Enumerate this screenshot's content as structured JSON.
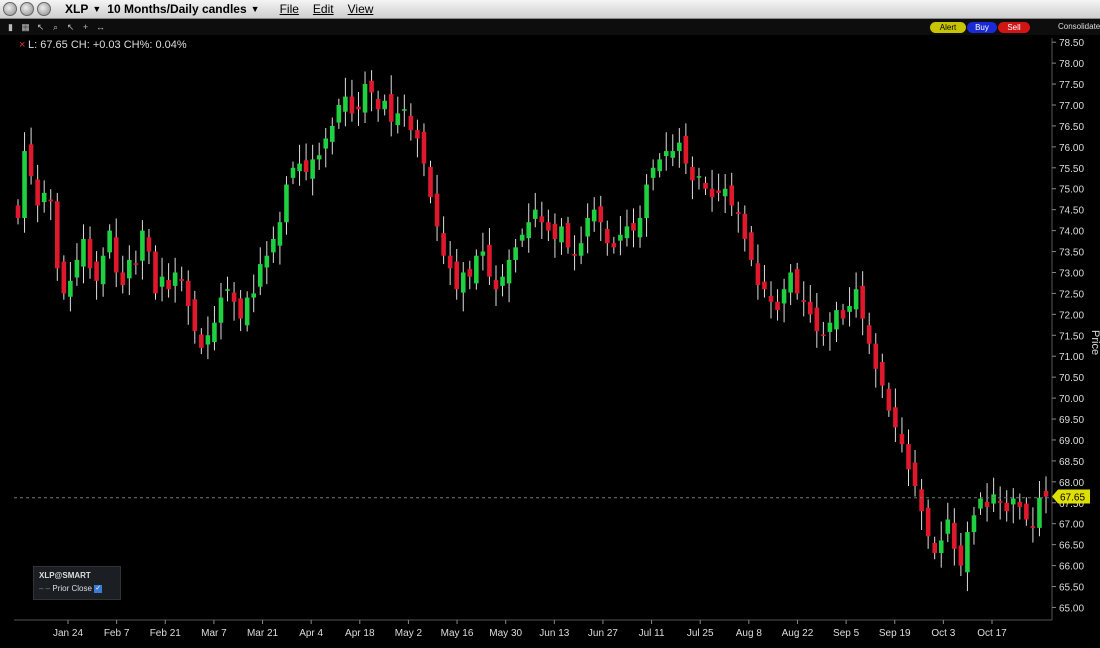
{
  "header": {
    "symbol": "XLP",
    "period": "10 Months/Daily candles",
    "menus": [
      "File",
      "Edit",
      "View"
    ],
    "consolidate": "Consolidate"
  },
  "actions": {
    "alert": "Alert",
    "buy": "Buy",
    "sell": "Sell"
  },
  "colors": {
    "up": "#1fd040",
    "down": "#e0182c",
    "alert": "#c9c400",
    "buy": "#1a2bd6",
    "sell": "#d11414",
    "price_tag": "#e0e000"
  },
  "icons": {
    "window_buttons": [
      "close-icon",
      "minimize-icon",
      "zoom-icon"
    ],
    "tools": [
      "bar-icon",
      "grid-icon",
      "cursor-icon",
      "zoom-icon",
      "cursor-icon",
      "crosshair-icon",
      "pan-icon"
    ]
  },
  "quote_line": "L: 67.65 CH: +0.03 CH%: 0.04%",
  "legend": {
    "title": "XLP@SMART",
    "prior_close": "Prior Close"
  },
  "price_tag": "67.65",
  "chart_data": {
    "type": "candlestick",
    "ylabel": "Price",
    "ylim": [
      64.7,
      78.6
    ],
    "y_ticks": [
      "78.50",
      "78.00",
      "77.50",
      "77.00",
      "76.50",
      "76.00",
      "75.50",
      "75.00",
      "74.50",
      "74.00",
      "73.50",
      "73.00",
      "72.50",
      "72.00",
      "71.50",
      "71.00",
      "70.50",
      "70.00",
      "69.50",
      "69.00",
      "68.50",
      "68.00",
      "67.50",
      "67.00",
      "66.50",
      "66.00",
      "65.50",
      "65.00"
    ],
    "x_labels": [
      "Jan 24",
      "Feb 7",
      "Feb 21",
      "Mar 7",
      "Mar 21",
      "Apr 4",
      "Apr 18",
      "May 2",
      "May 16",
      "May 30",
      "Jun 13",
      "Jun 27",
      "Jul 11",
      "Jul 25",
      "Aug 8",
      "Aug 22",
      "Sep 5",
      "Sep 19",
      "Oct 3",
      "Oct 17"
    ],
    "prior_close": 67.62,
    "last": 67.65,
    "close_path": [
      74.3,
      75.9,
      75.3,
      74.6,
      74.9,
      74.7,
      73.1,
      72.5,
      72.8,
      73.3,
      73.8,
      73.1,
      72.8,
      73.4,
      74.0,
      73.0,
      72.7,
      73.3,
      73.2,
      74.0,
      73.5,
      72.5,
      72.9,
      72.6,
      73.0,
      72.8,
      72.2,
      71.6,
      71.2,
      71.5,
      71.8,
      72.4,
      72.6,
      72.3,
      71.9,
      72.4,
      72.5,
      73.2,
      73.4,
      73.8,
      74.2,
      75.1,
      75.5,
      75.6,
      75.4,
      75.7,
      75.8,
      76.2,
      76.5,
      77.0,
      77.2,
      76.8,
      76.9,
      77.5,
      77.3,
      76.9,
      77.1,
      76.6,
      76.8,
      76.9,
      76.4,
      76.2,
      75.6,
      74.8,
      74.1,
      73.4,
      73.1,
      72.6,
      73.0,
      72.9,
      73.4,
      73.5,
      72.9,
      72.6,
      72.9,
      73.3,
      73.6,
      73.9,
      74.2,
      74.5,
      74.2,
      74.0,
      73.8,
      74.1,
      73.6,
      73.4,
      73.7,
      74.3,
      74.5,
      74.2,
      73.7,
      73.6,
      73.9,
      74.1,
      74.0,
      74.3,
      75.1,
      75.5,
      75.7,
      75.9,
      75.9,
      76.1,
      75.6,
      75.2,
      75.3,
      75.0,
      74.8,
      74.9,
      75.0,
      74.6,
      74.4,
      73.8,
      73.3,
      72.7,
      72.6,
      72.3,
      72.1,
      72.6,
      73.0,
      72.5,
      72.3,
      72.0,
      71.6,
      71.5,
      71.8,
      72.1,
      71.9,
      72.2,
      72.6,
      71.9,
      71.3,
      70.7,
      70.3,
      69.7,
      69.3,
      68.9,
      68.3,
      67.9,
      67.3,
      66.7,
      66.3,
      66.6,
      67.1,
      66.4,
      66.0,
      66.8,
      67.2,
      67.6,
      67.4,
      67.7,
      67.5,
      67.3,
      67.6,
      67.4,
      67.1,
      66.9,
      67.62,
      67.65
    ]
  }
}
